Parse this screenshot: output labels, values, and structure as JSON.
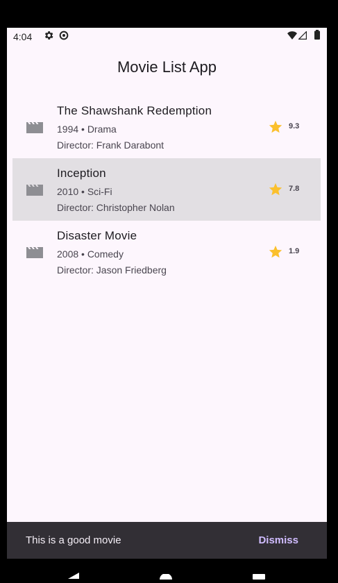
{
  "status_bar": {
    "time": "4:04",
    "icons": [
      "settings-gear-icon",
      "data-saver-icon",
      "wifi-icon",
      "signal-icon",
      "battery-icon"
    ]
  },
  "app_bar": {
    "title": "Movie List App"
  },
  "movies": [
    {
      "title": "The Shawshank Redemption",
      "subtitle": "1994 • Drama",
      "director": "Director: Frank Darabont",
      "rating": "9.3",
      "icon": "movie-clapper-icon",
      "selected": false
    },
    {
      "title": "Inception",
      "subtitle": "2010 • Sci-Fi",
      "director": "Director: Christopher Nolan",
      "rating": "7.8",
      "icon": "movie-clapper-icon",
      "selected": true
    },
    {
      "title": "Disaster Movie",
      "subtitle": "2008 • Comedy",
      "director": "Director: Jason Friedberg",
      "rating": "1.9",
      "icon": "movie-clapper-icon",
      "selected": false
    }
  ],
  "snackbar": {
    "message": "This is a good movie",
    "action": "Dismiss"
  },
  "colors": {
    "background": "#fdf6fd",
    "selected_row": "#e2dfe3",
    "star": "#fbc02d",
    "snackbar_bg": "#322f35",
    "snackbar_action": "#d0bcff"
  },
  "nav": {
    "icons": [
      "back-icon",
      "home-icon",
      "recents-icon"
    ]
  }
}
